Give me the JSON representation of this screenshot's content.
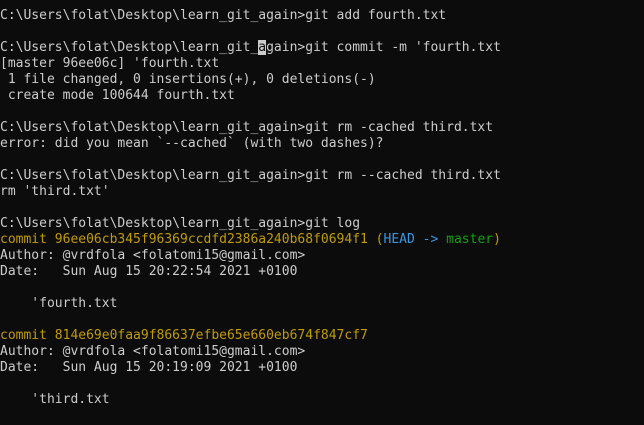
{
  "colors": {
    "background": "#0c0c0c",
    "text": "#cccccc",
    "commit_hash": "#c19c00",
    "head_ref": "#3a96dd",
    "branch_name": "#13a10e"
  },
  "commands": {
    "add": {
      "prompt": "C:\\Users\\folat\\Desktop\\learn_git_again>",
      "text": "git add fourth.txt"
    },
    "commit": {
      "prompt_before_cursor": "C:\\Users\\folat\\Desktop\\learn_git_",
      "cursor_char": "a",
      "prompt_after_cursor": "gain>",
      "text": "git commit -m 'fourth.txt"
    },
    "rm_single_dash": {
      "prompt": "C:\\Users\\folat\\Desktop\\learn_git_again>",
      "text": "git rm -cached third.txt"
    },
    "rm_double_dash": {
      "prompt": "C:\\Users\\folat\\Desktop\\learn_git_again>",
      "text": "git rm --cached third.txt"
    },
    "log": {
      "prompt": "C:\\Users\\folat\\Desktop\\learn_git_again>",
      "text": "git log"
    }
  },
  "outputs": {
    "commit_result": [
      "[master 96ee06c] 'fourth.txt",
      " 1 file changed, 0 insertions(+), 0 deletions(-)",
      " create mode 100644 fourth.txt"
    ],
    "rm_error": "error: did you mean `--cached` (with two dashes)?",
    "rm_result": "rm 'third.txt'"
  },
  "log_entries": [
    {
      "commit_line": "commit 96ee06cb345f96369ccdfd2386a240b68f0694f1",
      "ref_open": " (",
      "head_ref": "HEAD ->",
      "ref_space": " ",
      "branch": "master",
      "ref_close": ")",
      "author": "Author: @vrdfola <folatomi15@gmail.com>",
      "date": "Date:   Sun Aug 15 20:22:54 2021 +0100",
      "message": "    'fourth.txt"
    },
    {
      "commit_line": "commit 814e69e0faa9f86637efbe65e660eb674f847cf7",
      "author": "Author: @vrdfola <folatomi15@gmail.com>",
      "date": "Date:   Sun Aug 15 20:19:09 2021 +0100",
      "message": "    'third.txt"
    }
  ]
}
